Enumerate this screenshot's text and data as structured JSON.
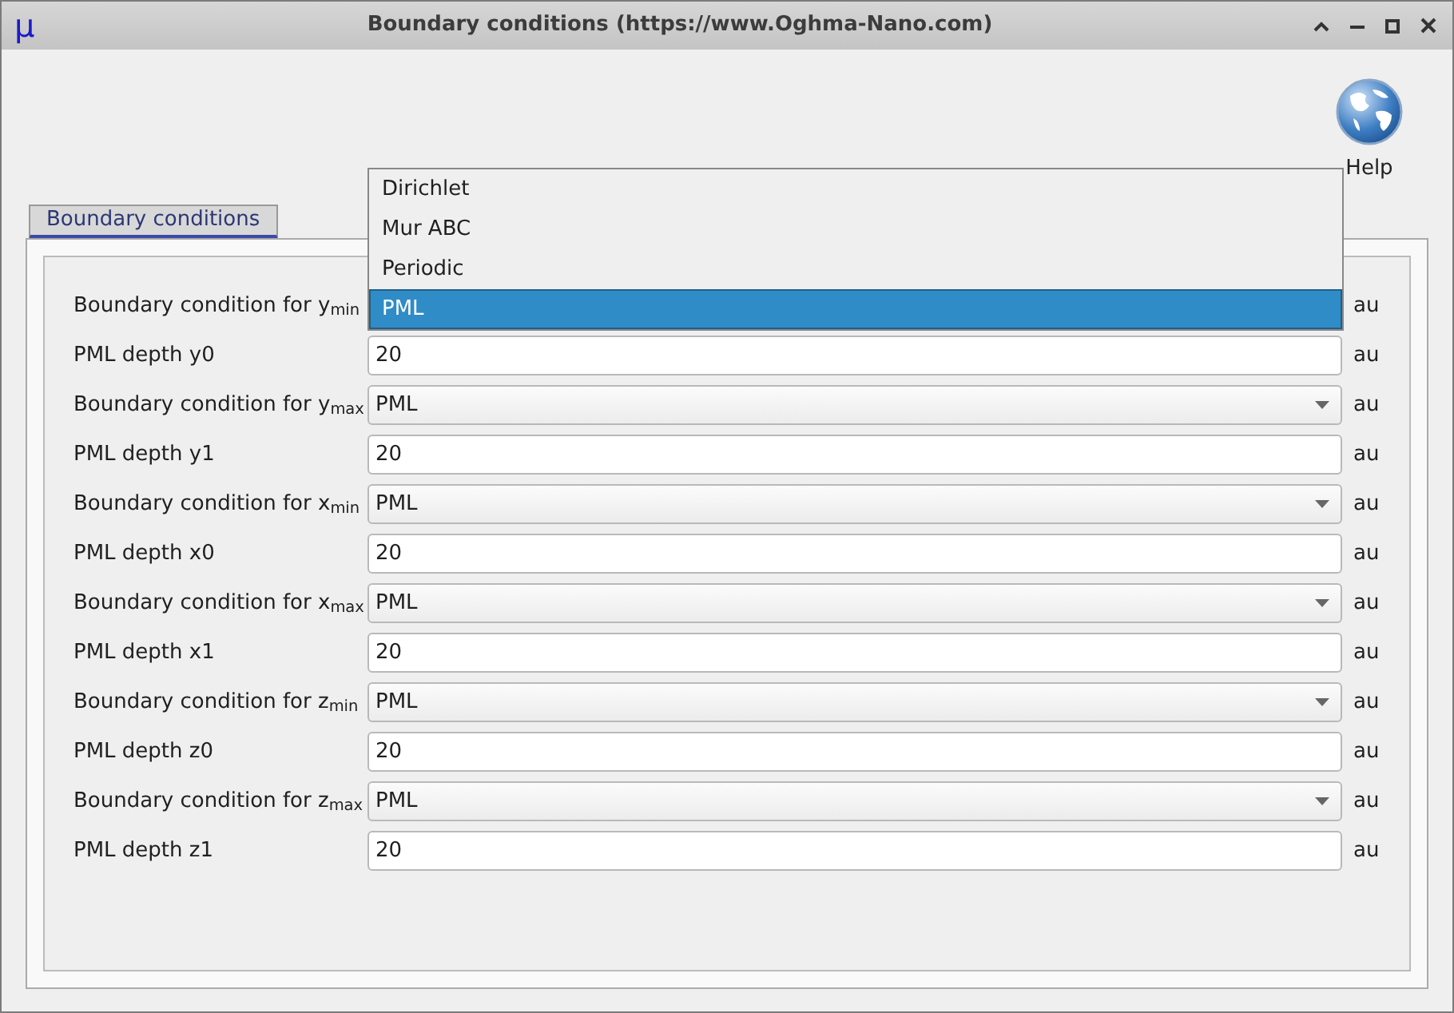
{
  "window": {
    "icon": "μ",
    "title": "Boundary conditions (https://www.Oghma-Nano.com)"
  },
  "toolbar": {
    "help_label": "Help"
  },
  "tabs": [
    {
      "label": "Boundary conditions",
      "selected": true
    }
  ],
  "rows": [
    {
      "kind": "select",
      "label": "Boundary condition for y$_{min}$",
      "unit": "au"
    },
    {
      "kind": "input",
      "label": "PML depth y0",
      "value": "20",
      "unit": "au"
    },
    {
      "kind": "select",
      "label": "Boundary condition for y$_{max}$",
      "value": "PML",
      "unit": "au"
    },
    {
      "kind": "input",
      "label": "PML depth y1",
      "value": "20",
      "unit": "au"
    },
    {
      "kind": "select",
      "label": "Boundary condition for x$_{min}$",
      "value": "PML",
      "unit": "au"
    },
    {
      "kind": "input",
      "label": "PML depth x0",
      "value": "20",
      "unit": "au"
    },
    {
      "kind": "select",
      "label": "Boundary condition for x$_{max}$",
      "value": "PML",
      "unit": "au"
    },
    {
      "kind": "input",
      "label": "PML depth x1",
      "value": "20",
      "unit": "au"
    },
    {
      "kind": "select",
      "label": "Boundary condition for z$_{min}$",
      "value": "PML",
      "unit": "au"
    },
    {
      "kind": "input",
      "label": "PML depth z0",
      "value": "20",
      "unit": "au"
    },
    {
      "kind": "select",
      "label": "Boundary condition for z$_{max}$",
      "value": "PML",
      "unit": "au"
    },
    {
      "kind": "input",
      "label": "PML depth z1",
      "value": "20",
      "unit": "au"
    }
  ],
  "dropdown": {
    "options": [
      {
        "label": "Dirichlet",
        "selected": false
      },
      {
        "label": "Mur ABC",
        "selected": false
      },
      {
        "label": "Periodic",
        "selected": false
      },
      {
        "label": "PML",
        "selected": true
      }
    ]
  }
}
